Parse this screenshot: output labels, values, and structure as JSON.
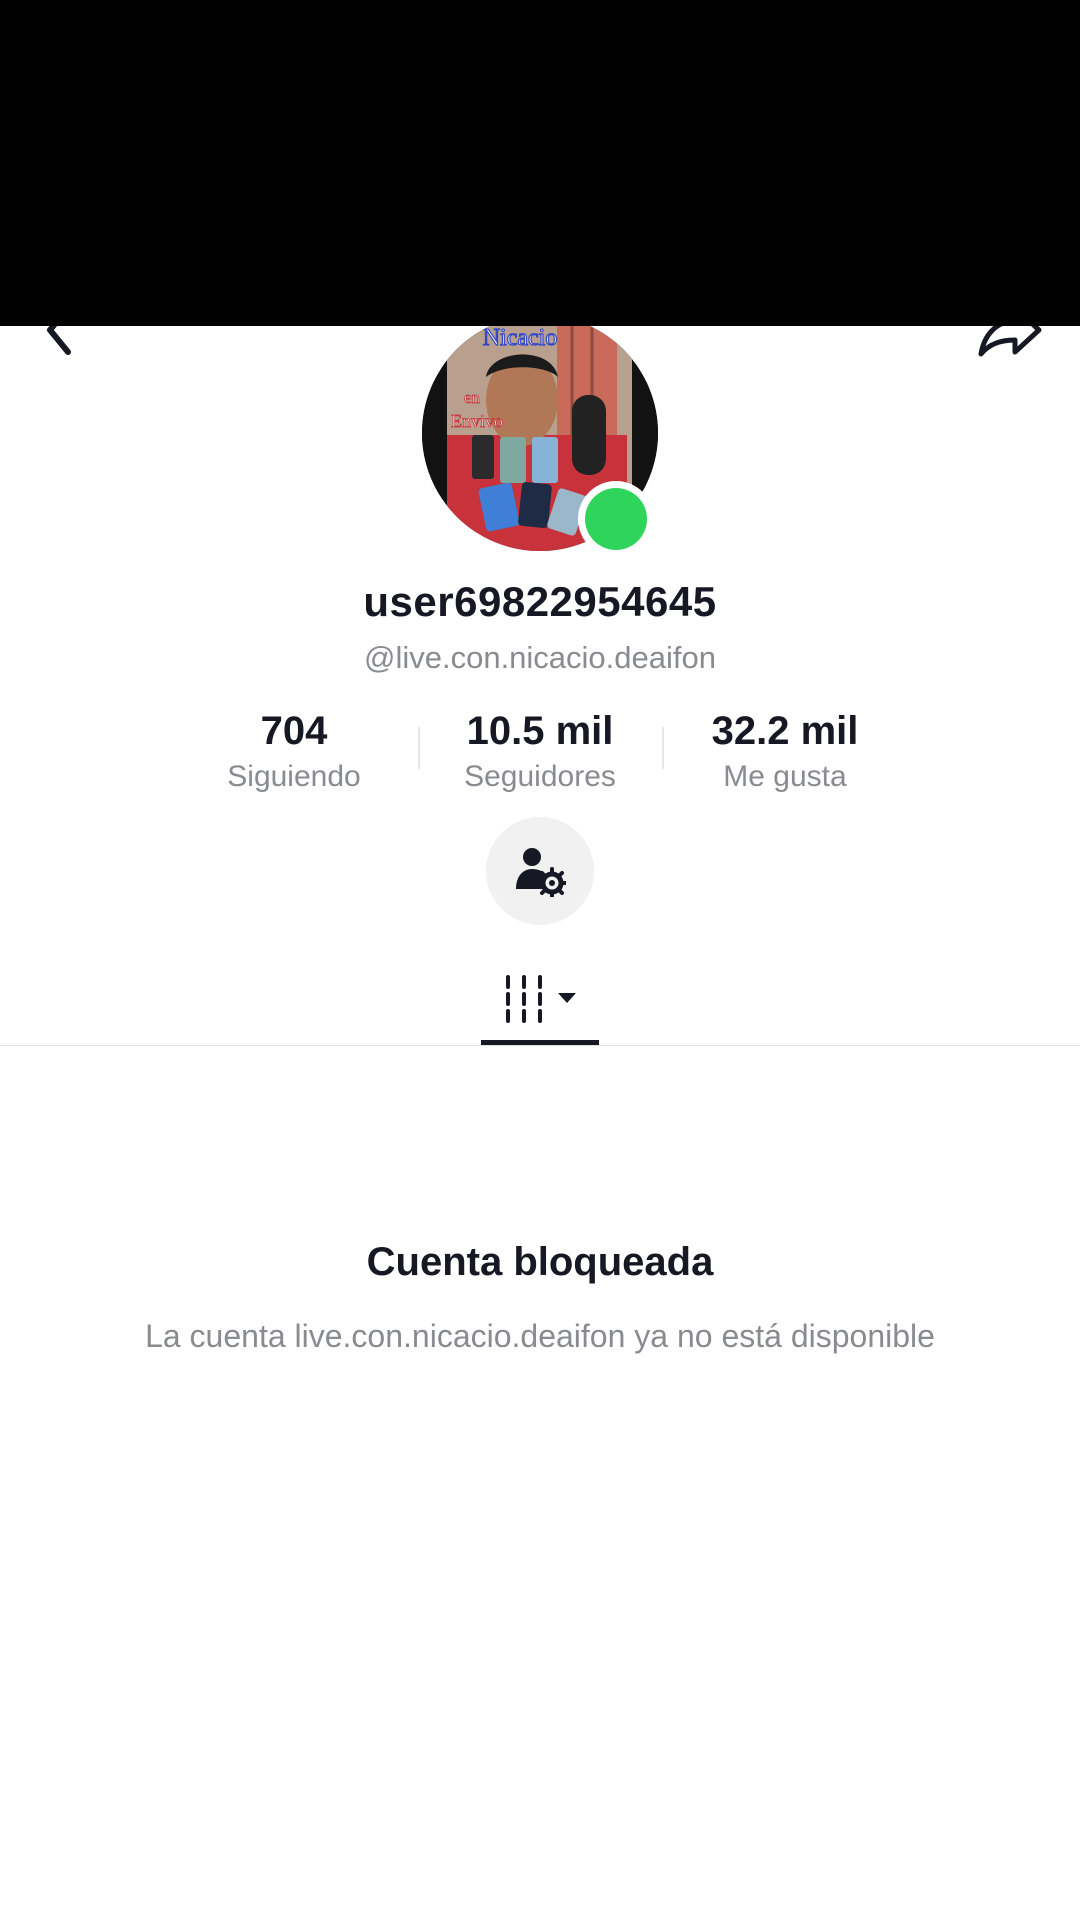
{
  "header": {
    "back_icon": "chevron-left-icon",
    "share_icon": "share-arrow-icon"
  },
  "profile": {
    "avatar_overlay_title": "Nicacio",
    "avatar_overlay_line1": "en",
    "avatar_overlay_line2": "Envivo",
    "live_status_color": "#2fd45a",
    "display_name": "user69822954645",
    "handle": "@live.con.nicacio.deaifon"
  },
  "stats": [
    {
      "value": "704",
      "label": "Siguiendo"
    },
    {
      "value": "10.5 mil",
      "label": "Seguidores"
    },
    {
      "value": "32.2 mil",
      "label": "Me gusta"
    }
  ],
  "actions": {
    "friend_settings_icon": "person-gear-icon"
  },
  "tabs": {
    "videos_icon": "video-grid-icon",
    "dropdown_icon": "caret-down-icon"
  },
  "blocked": {
    "title": "Cuenta bloqueada",
    "message": "La cuenta live.con.nicacio.deaifon ya no está disponible"
  }
}
